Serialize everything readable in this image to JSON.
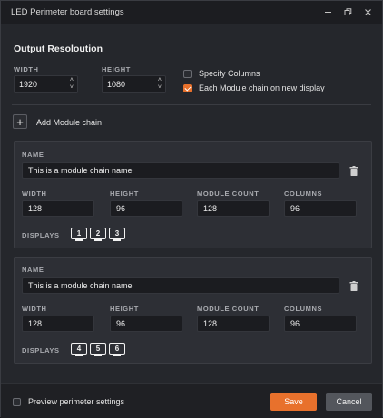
{
  "window": {
    "title": "LED Perimeter board settings",
    "minimize_icon": "minimize-icon",
    "restore_icon": "restore-icon",
    "close_icon": "close-icon"
  },
  "output": {
    "section_title": "Output Resoloution",
    "width_label": "WIDTH",
    "width_value": "1920",
    "height_label": "HEIGHT",
    "height_value": "1080",
    "specify_columns": {
      "label": "Specify Columns",
      "checked": false
    },
    "each_module": {
      "label": "Each Module chain on new display",
      "checked": true
    }
  },
  "add_module": {
    "label": "Add Module chain"
  },
  "chains": [
    {
      "name_label": "NAME",
      "name_value": "This is a module chain name",
      "width_label": "WIDTH",
      "width_value": "128",
      "height_label": "HEIGHT",
      "height_value": "96",
      "count_label": "MODULE COUNT",
      "count_value": "128",
      "columns_label": "COLUMNS",
      "columns_value": "96",
      "displays_label": "DISPLAYS",
      "displays": [
        "1",
        "2",
        "3"
      ]
    },
    {
      "name_label": "NAME",
      "name_value": "This is a module chain name",
      "width_label": "WIDTH",
      "width_value": "128",
      "height_label": "HEIGHT",
      "height_value": "96",
      "count_label": "MODULE COUNT",
      "count_value": "128",
      "columns_label": "COLUMNS",
      "columns_value": "96",
      "displays_label": "DISPLAYS",
      "displays": [
        "4",
        "5",
        "6"
      ]
    }
  ],
  "footer": {
    "preview_label": "Preview perimeter settings",
    "preview_checked": false,
    "save_label": "Save",
    "cancel_label": "Cancel"
  },
  "colors": {
    "accent": "#e8712c",
    "background": "#25272c",
    "panel": "#2d2f35"
  }
}
